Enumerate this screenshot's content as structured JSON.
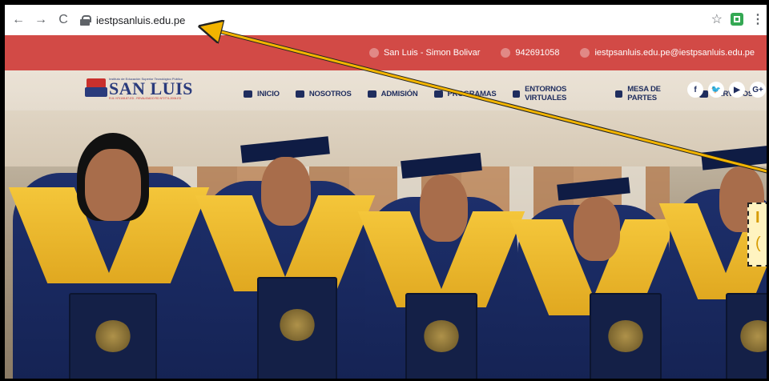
{
  "browser": {
    "url": "iestpsanluis.edu.pe",
    "back_icon": "arrow-left-icon",
    "forward_icon": "arrow-right-icon",
    "reload_icon": "reload-icon",
    "bookmark_icon": "star-icon",
    "menu_icon": "kebab-icon"
  },
  "topbar": {
    "location": "San Luis - Simon Bolivar",
    "phone": "942691058",
    "email": "iestpsanluis.edu.pe@iestpsanluis.edu.pe",
    "color": "#d24a46"
  },
  "logo": {
    "small_line": "Instituto de Educación Superior Tecnológico Público",
    "name": "SAN LUIS",
    "small_line2": "R.M. N°0108-87-ED - REVALIDADO RD N°0774-2006-ED"
  },
  "nav": {
    "items": [
      {
        "label": "INICIO",
        "icon": "home-icon"
      },
      {
        "label": "NOSOTROS",
        "icon": "users-icon"
      },
      {
        "label": "ADMISIÓN",
        "icon": "graduation-cap-icon"
      },
      {
        "label": "PROGRAMAS",
        "icon": "book-icon"
      },
      {
        "label": "ENTORNOS VIRTUALES",
        "icon": "laptop-icon"
      },
      {
        "label": "MESA DE PARTES",
        "icon": "id-card-icon"
      },
      {
        "label": "SERVICIOS",
        "icon": "users-icon"
      }
    ],
    "social": [
      {
        "label": "f",
        "icon": "facebook-icon"
      },
      {
        "label": "🐦",
        "icon": "twitter-icon"
      },
      {
        "label": "▶",
        "icon": "youtube-icon"
      },
      {
        "label": "G+",
        "icon": "google-plus-icon"
      }
    ],
    "text_color": "#1f2d5e"
  },
  "annotation": {
    "callout_line1": "I",
    "callout_line2": "(",
    "arrow_color": "#f2b400"
  }
}
